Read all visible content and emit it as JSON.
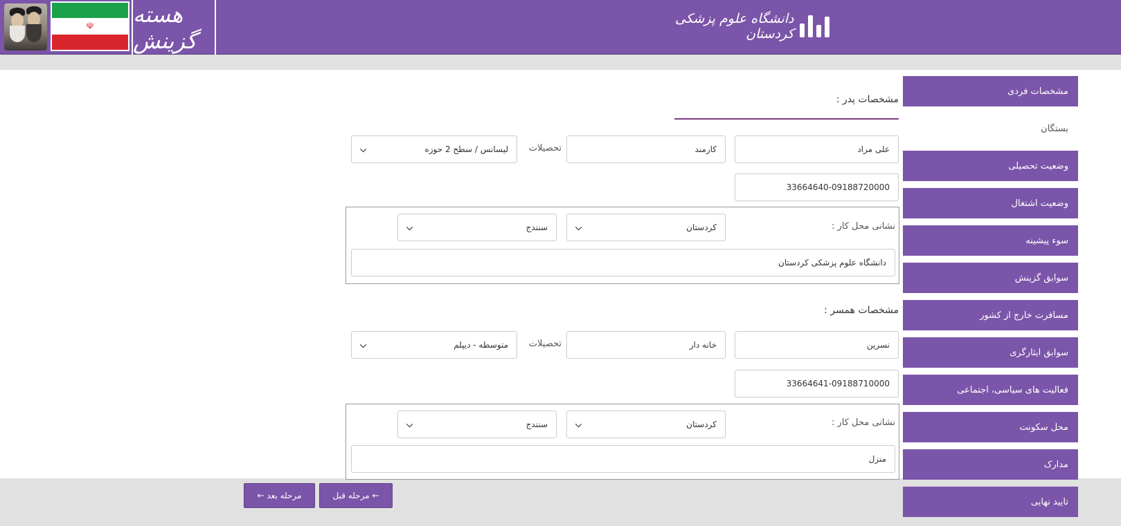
{
  "header": {
    "brand_text": "هسته گزینش",
    "university_text": "دانشگاه علوم پزشکی کردستان",
    "flag_emblem": "☫",
    "colors": {
      "primary": "#7b55a9",
      "band": "#e1e1e1",
      "accent_rule": "#7b3d82"
    }
  },
  "sidebar": {
    "items": [
      {
        "label": "مشخصات فردی",
        "active": false
      },
      {
        "label": "بستگان",
        "active": true
      },
      {
        "label": "وضعیت تحصیلی",
        "active": false
      },
      {
        "label": "وضعیت اشتغال",
        "active": false
      },
      {
        "label": "سوء پیشینه",
        "active": false
      },
      {
        "label": "سوابق گزینش",
        "active": false
      },
      {
        "label": "مسافرت خارج از کشور",
        "active": false
      },
      {
        "label": "سوابق ایثارگری",
        "active": false
      },
      {
        "label": "فعالیت های سیاسی، اجتماعی",
        "active": false
      },
      {
        "label": "محل سکونت",
        "active": false
      },
      {
        "label": "مدارک",
        "active": false
      },
      {
        "label": "تایید نهایی",
        "active": false
      }
    ]
  },
  "father": {
    "title": "مشخصات پدر :",
    "name": "علی مراد",
    "job": "کارمند",
    "education_label": "تحصیلات",
    "education": "لیسانس / سطح 2 حوزه",
    "phone": "33664640-09188720000",
    "workplace_label": "نشانی محل کار :",
    "province": "کردستان",
    "city": "سنندج",
    "address": "دانشگاه علوم پزشکی کردستان"
  },
  "spouse": {
    "title": "مشخصات همسر :",
    "name": "نسرین",
    "job": "خانه دار",
    "education_label": "تحصیلات",
    "education": "متوسطه - دیپلم",
    "phone": "33664641-09188710000",
    "workplace_label": "نشانی محل کار :",
    "province": "کردستان",
    "city": "سنندج",
    "address": "منزل"
  },
  "nav": {
    "prev_label": "← مرحله قبل",
    "next_label": "مرحله بعد ←"
  }
}
